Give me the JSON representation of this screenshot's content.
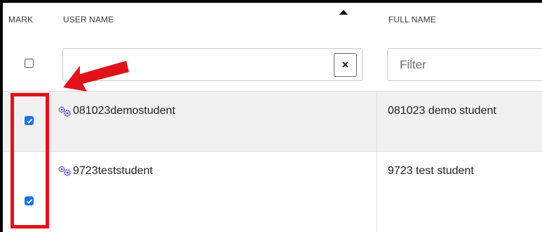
{
  "table": {
    "columns": {
      "mark": "MARK",
      "user_name": "USER NAME",
      "full_name": "FULL NAME"
    },
    "sort": {
      "column": "user_name",
      "direction": "ascending"
    },
    "filters": {
      "user_name": {
        "value": "",
        "clear_label": "×"
      },
      "full_name": {
        "placeholder": "Filter"
      }
    },
    "rows": [
      {
        "marked": true,
        "user_name": "081023demostudent",
        "full_name": "081023 demo student"
      },
      {
        "marked": true,
        "user_name": "9723teststudent",
        "full_name": "9723 test student"
      }
    ]
  },
  "annotations": {
    "highlight_color": "#e2121b",
    "arrow_color": "#e2121b"
  },
  "colors": {
    "checkbox_checked": "#1a73e8",
    "user_icon": "#3f3fd8",
    "selected_row_bg": "#f1f1f1"
  }
}
